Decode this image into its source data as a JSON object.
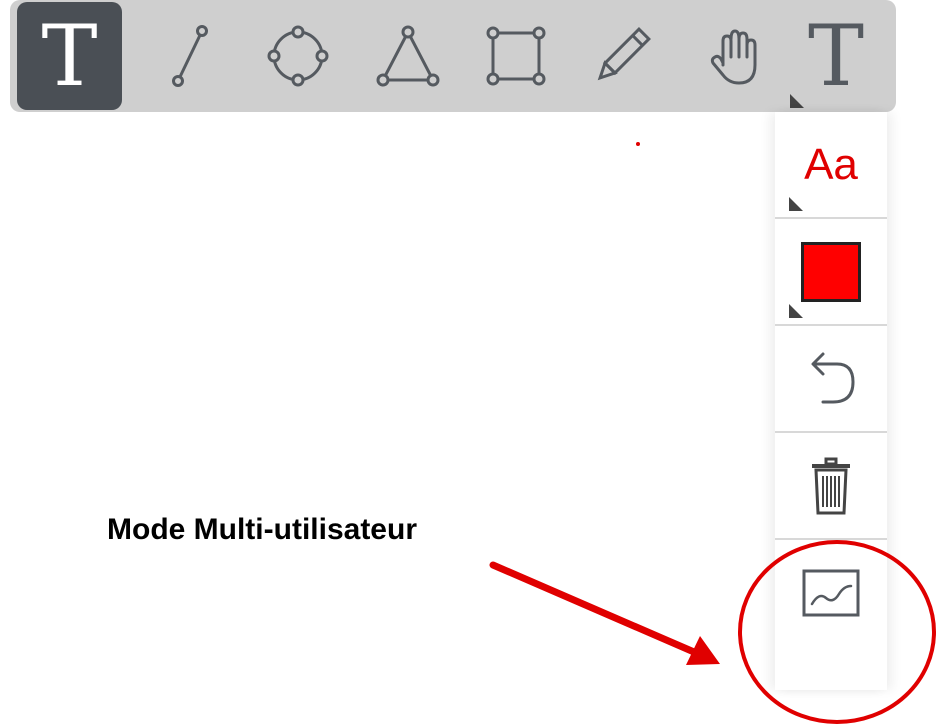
{
  "top_toolbar": {
    "tools": [
      {
        "name": "text-tool",
        "glyph": "T",
        "selected": true
      },
      {
        "name": "line-tool",
        "icon": "line-icon"
      },
      {
        "name": "circle-tool",
        "icon": "circle-icon"
      },
      {
        "name": "triangle-tool",
        "icon": "triangle-icon"
      },
      {
        "name": "rectangle-tool",
        "icon": "rectangle-icon"
      },
      {
        "name": "pencil-tool",
        "icon": "pencil-icon"
      },
      {
        "name": "pan-tool",
        "icon": "hand-icon"
      },
      {
        "name": "text-style-tool",
        "glyph": "T"
      }
    ]
  },
  "side_toolbar": {
    "font_button_label": "Aa",
    "font_color": "#e00000",
    "swatch_color": "#ff0000",
    "undo_icon": "undo-icon",
    "delete_icon": "trash-icon",
    "multiuser_icon": "chart-line-icon"
  },
  "annotation": {
    "label": "Mode Multi-utilisateur",
    "color": "#e00000"
  }
}
